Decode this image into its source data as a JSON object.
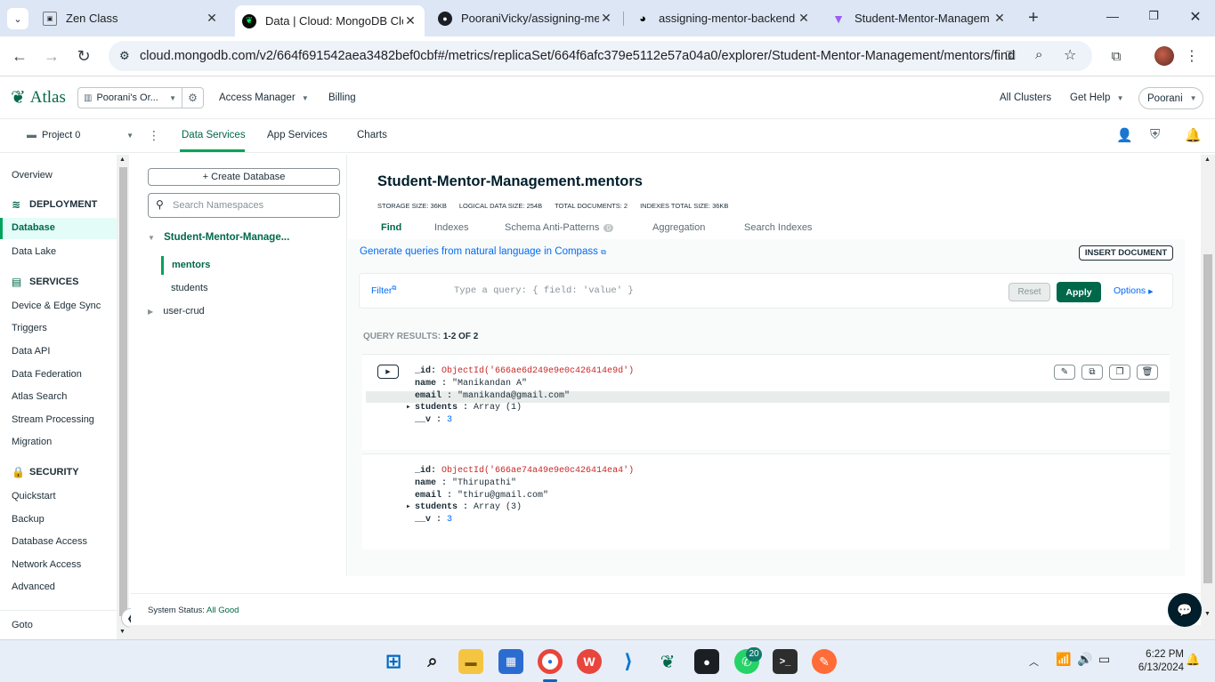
{
  "browser": {
    "tabs": [
      {
        "label": "Zen Class",
        "icon": "zen-icon"
      },
      {
        "label": "Data | Cloud: MongoDB Clou",
        "icon": "mongodb-leaf-icon"
      },
      {
        "label": "PooraniVicky/assigning-mer",
        "icon": "github-icon"
      },
      {
        "label": "assigning-mentor-backend",
        "icon": "render-icon"
      },
      {
        "label": "Student-Mentor-Managem",
        "icon": "vite-icon"
      }
    ],
    "url": "cloud.mongodb.com/v2/664f691542aea3482bef0cbf#/metrics/replicaSet/664f6afc379e5112e57a04a0/explorer/Student-Mentor-Management/mentors/find"
  },
  "atlas": {
    "brand": "Atlas",
    "org": "Poorani's Or...",
    "access_manager": "Access Manager",
    "billing": "Billing",
    "all_clusters": "All Clusters",
    "get_help": "Get Help",
    "user": "Poorani",
    "project": "Project 0",
    "tabs": [
      "Data Services",
      "App Services",
      "Charts"
    ]
  },
  "leftnav": {
    "overview": "Overview",
    "deployment": "DEPLOYMENT",
    "deployment_items": [
      "Database",
      "Data Lake"
    ],
    "services": "SERVICES",
    "services_items": [
      "Device & Edge Sync",
      "Triggers",
      "Data API",
      "Data Federation",
      "Atlas Search",
      "Stream Processing",
      "Migration"
    ],
    "security": "SECURITY",
    "security_items": [
      "Quickstart",
      "Backup",
      "Database Access",
      "Network Access",
      "Advanced"
    ],
    "goto": "Goto"
  },
  "dbpanel": {
    "create_db": "+ Create Database",
    "search_placeholder": "Search Namespaces",
    "database": "Student-Mentor-Manage...",
    "collections": [
      "mentors",
      "students"
    ],
    "other_db": "user-crud"
  },
  "collection": {
    "title": "Student-Mentor-Management.mentors",
    "stats": [
      {
        "label": "STORAGE SIZE:",
        "value": "36KB"
      },
      {
        "label": "LOGICAL DATA SIZE:",
        "value": "254B"
      },
      {
        "label": "TOTAL DOCUMENTS:",
        "value": "2"
      },
      {
        "label": "INDEXES TOTAL SIZE:",
        "value": "36KB"
      }
    ],
    "tabs": [
      "Find",
      "Indexes",
      "Schema Anti-Patterns",
      "Aggregation",
      "Search Indexes"
    ],
    "anti_patterns_count": "0",
    "nl_link": "Generate queries from natural language in Compass",
    "insert_doc": "INSERT DOCUMENT",
    "filter_label": "Filter",
    "query_placeholder": "Type a query: { field: 'value' }",
    "reset": "Reset",
    "apply": "Apply",
    "options": "Options",
    "results_label": "QUERY RESULTS:",
    "results_value": "1-2 OF 2"
  },
  "documents": [
    {
      "id": "ObjectId('666ae6d249e9e0c426414e9d')",
      "name": "\"Manikandan A\"",
      "email": "\"manikanda@gmail.com\"",
      "students": "Array (1)",
      "v": "3"
    },
    {
      "id": "ObjectId('666ae74a49e9e0c426414ea4')",
      "name": "\"Thirupathi\"",
      "email": "\"thiru@gmail.com\"",
      "students": "Array (3)",
      "v": "3"
    }
  ],
  "doc_keys": {
    "id": "_id",
    "name": "name",
    "email": "email",
    "students": "students",
    "v": "__v"
  },
  "footer": {
    "status_label": "System Status:",
    "status_value": "All Good"
  },
  "taskbar": {
    "time": "6:22 PM",
    "date": "6/13/2024",
    "whatsapp_badge": "20"
  }
}
